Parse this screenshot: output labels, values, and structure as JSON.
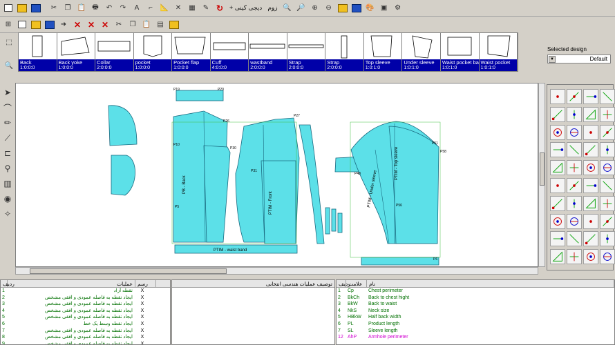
{
  "toolbar": {
    "zoom_label": "زوم",
    "draw_label": "+ دیجی کینی"
  },
  "pieces": [
    {
      "name": "Back",
      "count": "1:0:0:0"
    },
    {
      "name": "Back yoke",
      "count": "1:0:0:0"
    },
    {
      "name": "Collar",
      "count": "2:0:0:0"
    },
    {
      "name": "pocket",
      "count": "1:0:0:0"
    },
    {
      "name": "Pocket flap",
      "count": "1:0:0:0"
    },
    {
      "name": "Cuff",
      "count": "4:0:0:0"
    },
    {
      "name": "wastband",
      "count": "2:0:0:0"
    },
    {
      "name": "Strap",
      "count": "2:0:0:0"
    },
    {
      "name": "Strap",
      "count": "2:0:0:0"
    },
    {
      "name": "Top sleeve",
      "count": "1:0:1:0"
    },
    {
      "name": "Under sleeve",
      "count": "1:0:1:0"
    },
    {
      "name": "Waist pocket bag",
      "count": "1:0:1:0"
    },
    {
      "name": "Waist pocket",
      "count": "1:0:1:0"
    }
  ],
  "design": {
    "label": "Selected design",
    "value": "Default"
  },
  "canvas": {
    "labels": [
      "P19",
      "P20",
      "P26",
      "P27",
      "P30",
      "P31",
      "P58",
      "P51",
      "P10",
      "P5",
      "P56",
      "P48",
      "P6"
    ],
    "piece_texts": [
      "PB - Back",
      "PTIM - Front",
      "PTIM - Under sleeve",
      "PTIM - Top sleeve",
      "PTIM - waist band"
    ]
  },
  "operations": {
    "headers": [
      "ردیف",
      "عملیات",
      "رسم"
    ],
    "rows": [
      {
        "n": "1",
        "desc": "نقطه آزاد",
        "x": "X"
      },
      {
        "n": "2",
        "desc": "ایجاد نقطه به فاصله عمودی و افقی مشخص",
        "x": "X"
      },
      {
        "n": "3",
        "desc": "ایجاد نقطه به فاصله عمودی و افقی مشخص",
        "x": "X"
      },
      {
        "n": "4",
        "desc": "ایجاد نقطه به فاصله عمودی و افقی مشخص",
        "x": "X"
      },
      {
        "n": "5",
        "desc": "ایجاد نقطه به فاصله عمودی و افقی مشخص",
        "x": "X"
      },
      {
        "n": "6",
        "desc": "ایجاد نقطه وسط یک خط",
        "x": "X"
      },
      {
        "n": "7",
        "desc": "ایجاد نقطه به فاصله عمودی و افقی مشخص",
        "x": "X"
      },
      {
        "n": "8",
        "desc": "ایجاد نقطه به فاصله عمودی و افقی مشخص",
        "x": "X"
      },
      {
        "n": "9",
        "desc": "ایجاد نقطه به فاصله عمودی و افقی مشخص",
        "x": "X"
      }
    ]
  },
  "description_panel": {
    "header": "توصیف عملیات هندسی انتخابی"
  },
  "variables": {
    "headers": [
      "ردیف",
      "علامت",
      "نام"
    ],
    "rows": [
      {
        "n": "1",
        "abbr": "Cp",
        "name": "Chest perimeter",
        "color": "green"
      },
      {
        "n": "2",
        "abbr": "BkCh",
        "name": "Back to chest hight",
        "color": "green"
      },
      {
        "n": "3",
        "abbr": "BkW",
        "name": "Back to waist",
        "color": "green"
      },
      {
        "n": "4",
        "abbr": "NkS",
        "name": "Neck size",
        "color": "green"
      },
      {
        "n": "5",
        "abbr": "HBkW",
        "name": "Half back width",
        "color": "green"
      },
      {
        "n": "6",
        "abbr": "PL",
        "name": "Product length",
        "color": "green"
      },
      {
        "n": "7",
        "abbr": "SL",
        "name": "Sleeve length",
        "color": "green"
      },
      {
        "n": "12",
        "abbr": "AhP",
        "name": "Armhole perimeter",
        "color": "magenta"
      }
    ]
  },
  "colors": {
    "pattern_fill": "#5ce0e8",
    "selection_blue": "#0000a8",
    "tool_bg": "#d4d0c8"
  }
}
